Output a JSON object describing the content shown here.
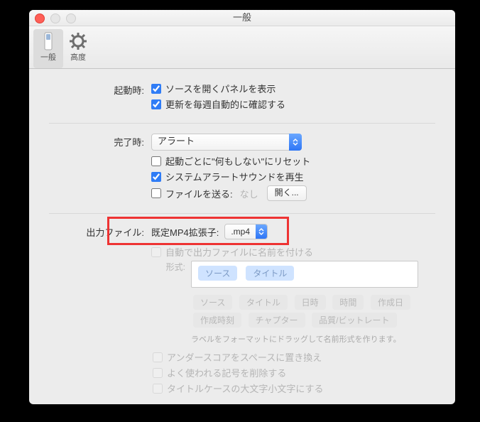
{
  "window": {
    "title": "一般"
  },
  "toolbar": {
    "tabs": [
      {
        "label": "一般",
        "selected": true
      },
      {
        "label": "高度",
        "selected": false
      }
    ]
  },
  "startup": {
    "label": "起動時:",
    "showSourcePanel": {
      "label": "ソースを開くパネルを表示",
      "checked": true
    },
    "checkUpdates": {
      "label": "更新を毎週自動的に確認する",
      "checked": true
    }
  },
  "completion": {
    "label": "完了時:",
    "action": "アラート",
    "resetEachLaunch": {
      "label": "起動ごとに\"何もしない\"にリセット",
      "checked": false
    },
    "playAlertSound": {
      "label": "システムアラートサウンドを再生",
      "checked": true
    },
    "sendFile": {
      "label": "ファイルを送る:",
      "checked": false,
      "destination": "なし",
      "browseButton": "開く..."
    }
  },
  "output": {
    "label": "出力ファイル:",
    "defaultExtLabel": "既定MP4拡張子:",
    "extension": ".mp4",
    "autoName": {
      "label": "自動で出力ファイルに名前を付ける",
      "checked": false
    },
    "formatLabel": "形式:",
    "formatTokens": [
      "ソース",
      "タイトル"
    ],
    "availableTokens": [
      "ソース",
      "タイトル",
      "日時",
      "時間",
      "作成日",
      "作成時刻",
      "チャプター",
      "品質/ビットレート"
    ],
    "dragHint": "ラベルをフォーマットにドラッグして名前形式を作ります。",
    "opts": {
      "underscore": {
        "label": "アンダースコアをスペースに置き換え",
        "checked": false
      },
      "removeSymbols": {
        "label": "よく使われる記号を削除する",
        "checked": false
      },
      "titlecase": {
        "label": "タイトルケースの大文字小文字にする",
        "checked": false
      }
    }
  }
}
